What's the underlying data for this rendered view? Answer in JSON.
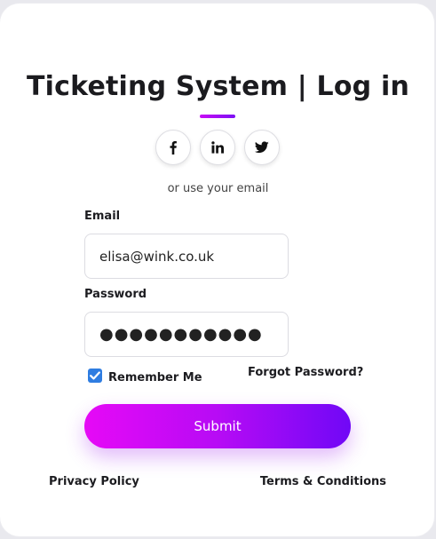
{
  "header": {
    "title": "Ticketing System | Log in"
  },
  "social": {
    "buttons": [
      {
        "icon": "facebook-icon"
      },
      {
        "icon": "linkedin-icon"
      },
      {
        "icon": "twitter-icon"
      }
    ],
    "alt_text": "or use your email"
  },
  "form": {
    "email_label": "Email",
    "email_value": "elisa@wink.co.uk",
    "password_label": "Password",
    "password_value": "●●●●●●●●●●●",
    "remember_label": "Remember Me",
    "remember_checked": true,
    "forgot_label": "Forgot Password?",
    "submit_label": "Submit"
  },
  "footer": {
    "privacy_label": "Privacy Policy",
    "terms_label": "Terms & Conditions"
  },
  "colors": {
    "accent_start": "#e609f6",
    "accent_end": "#7008f6",
    "checkbox": "#2f7de1"
  }
}
